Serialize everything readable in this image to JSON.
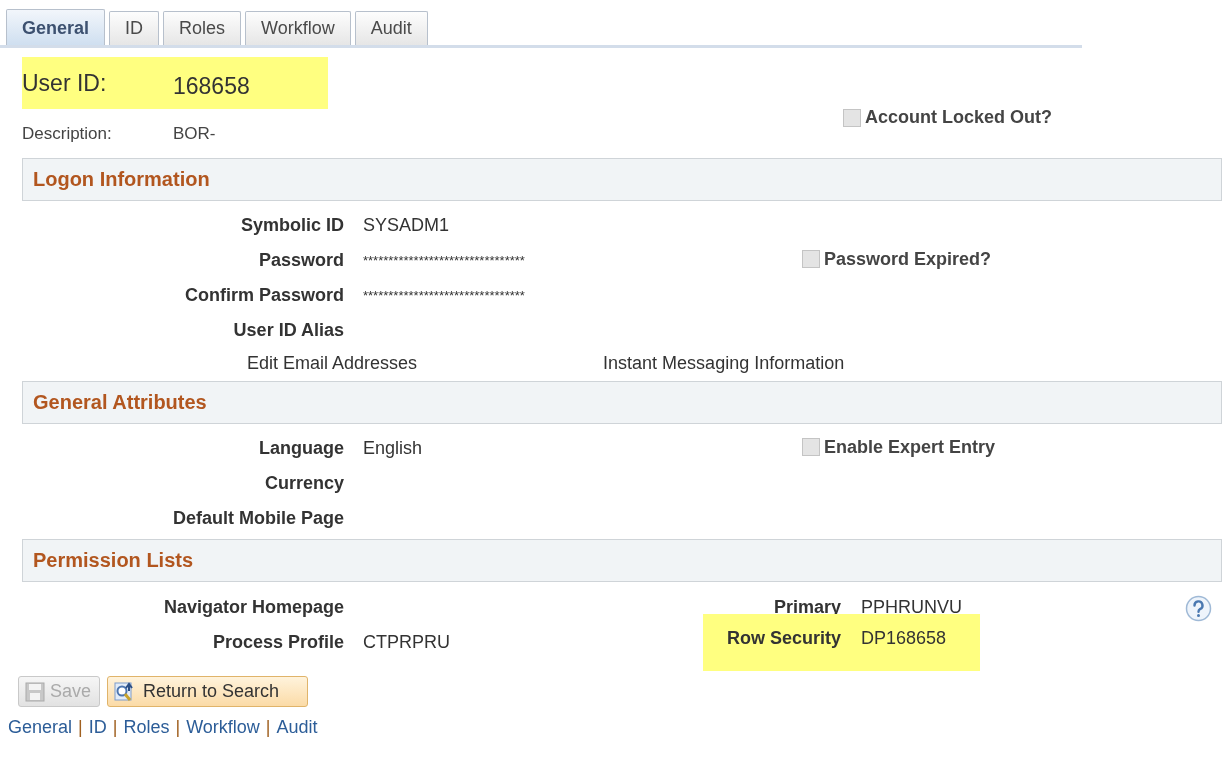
{
  "tabs": [
    {
      "label": "General",
      "selected": true
    },
    {
      "label": "ID",
      "selected": false
    },
    {
      "label": "Roles",
      "selected": false
    },
    {
      "label": "Workflow",
      "selected": false
    },
    {
      "label": "Audit",
      "selected": false
    }
  ],
  "user_id": {
    "label": "User ID:",
    "value": "168658",
    "highlighted": true
  },
  "description": {
    "label": "Description:",
    "value": "BOR-"
  },
  "account_locked_out": {
    "label": "Account Locked Out?",
    "checked": false,
    "disabled": true
  },
  "sections": [
    {
      "title": "Logon Information",
      "rows": [
        {
          "kind": "field",
          "label": "Symbolic ID",
          "value": "SYSADM1"
        },
        {
          "kind": "field",
          "label": "Password",
          "value": "********************************",
          "right": {
            "kind": "checkbox",
            "label": "Password Expired?",
            "checked": false,
            "disabled": true
          }
        },
        {
          "kind": "field",
          "label": "Confirm Password",
          "value": "********************************"
        },
        {
          "kind": "field",
          "label": "User ID Alias"
        },
        {
          "kind": "links",
          "links": [
            "Edit Email Addresses",
            "Instant Messaging Information"
          ]
        }
      ]
    },
    {
      "title": "General Attributes",
      "rows": [
        {
          "kind": "field",
          "label": "Language",
          "value": "English",
          "right": {
            "kind": "checkbox",
            "label": "Enable Expert Entry",
            "checked": false,
            "disabled": true
          }
        },
        {
          "kind": "field",
          "label": "Currency"
        },
        {
          "kind": "field",
          "label": "Default Mobile Page"
        }
      ]
    },
    {
      "title": "Permission Lists",
      "rows": [
        {
          "kind": "field",
          "label": "Navigator Homepage",
          "right": {
            "kind": "field",
            "label": "Primary",
            "value": "PPHRUNVU",
            "highlighted": false
          }
        },
        {
          "kind": "field",
          "label": "Process Profile",
          "value": "CTPRPRU",
          "right": {
            "kind": "field",
            "label": "Row Security",
            "value": "DP168658",
            "highlighted": true
          }
        }
      ]
    }
  ],
  "buttons": [
    {
      "kind": "save",
      "label": "Save",
      "disabled": true
    },
    {
      "kind": "return",
      "label": "Return to Search",
      "disabled": false
    }
  ],
  "footer_links": {
    "links": [
      "General",
      "ID",
      "Roles",
      "Workflow",
      "Audit"
    ],
    "separator": "|"
  }
}
